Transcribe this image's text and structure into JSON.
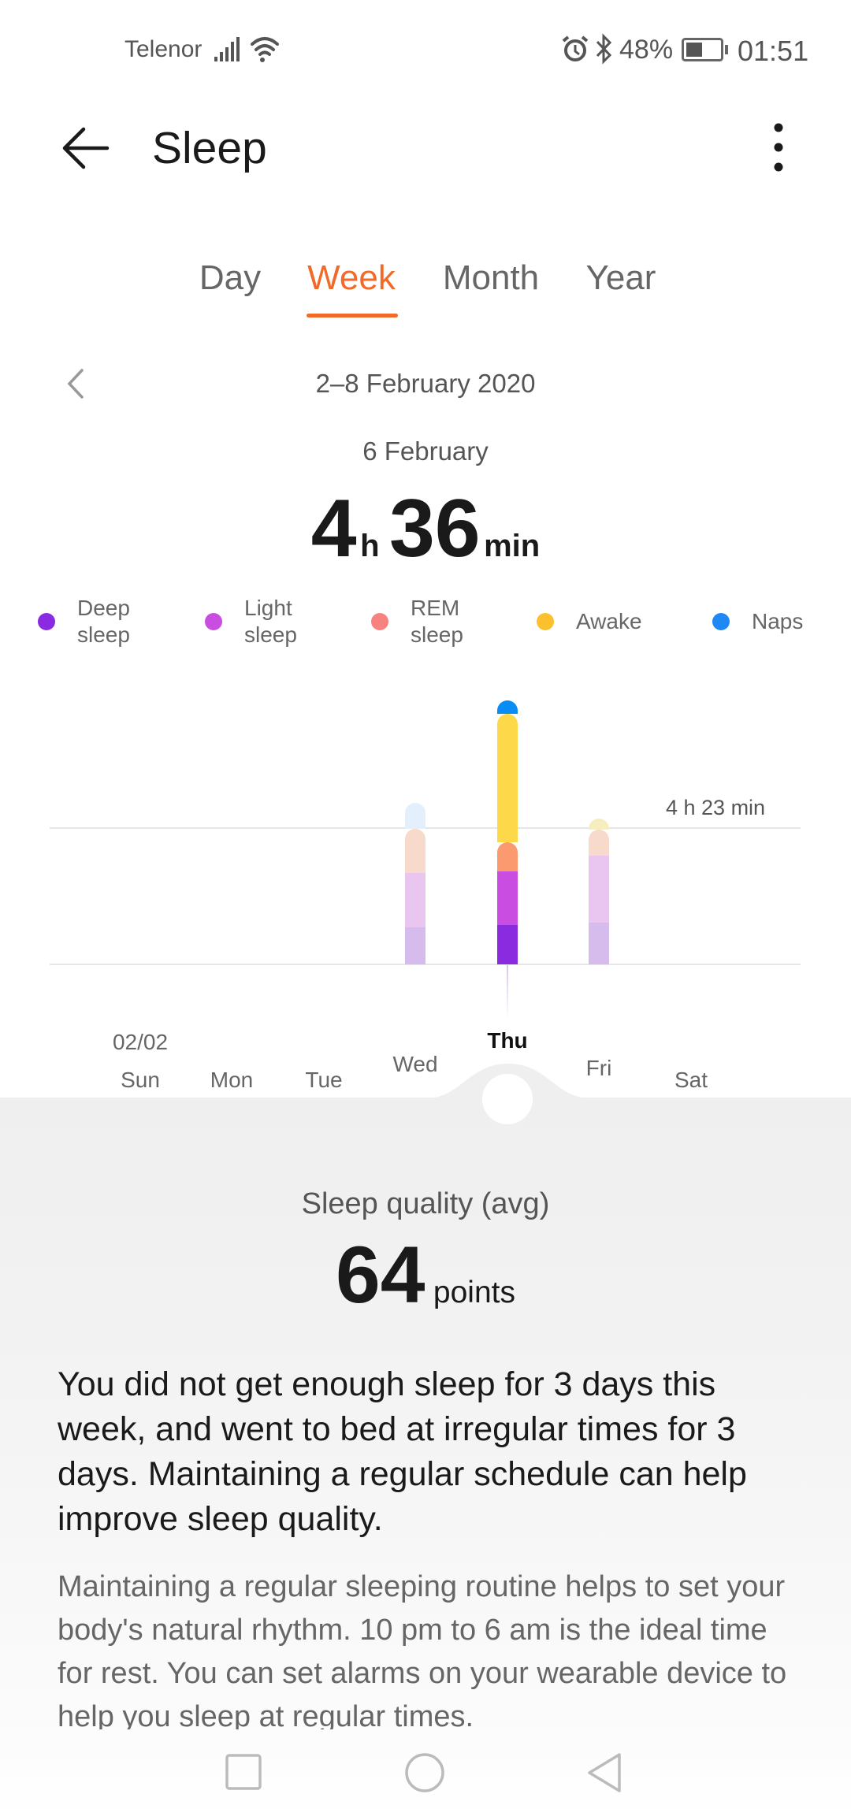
{
  "status_bar": {
    "carrier": "Telenor",
    "battery": "48%",
    "time": "01:51",
    "icons": [
      "signal-icon",
      "wifi-icon",
      "alarm-icon",
      "bluetooth-icon",
      "battery-icon"
    ]
  },
  "header": {
    "title": "Sleep",
    "back_icon": "arrow-left-icon",
    "menu_icon": "more-vertical-icon"
  },
  "tabs": [
    {
      "label": "Day"
    },
    {
      "label": "Week",
      "active": true
    },
    {
      "label": "Month"
    },
    {
      "label": "Year"
    }
  ],
  "period": {
    "range": "2–8 February 2020",
    "selected_date": "6 February",
    "hours": "4",
    "hours_unit": "h",
    "minutes": "36",
    "minutes_unit": "min"
  },
  "legend": [
    {
      "label": "Deep sleep",
      "color": "#8a2be2"
    },
    {
      "label": "Light sleep",
      "color": "#c84de0"
    },
    {
      "label": "REM sleep",
      "color": "#f8827f"
    },
    {
      "label": "Awake",
      "color": "#fbc02d"
    },
    {
      "label": "Naps",
      "color": "#1e88f5"
    }
  ],
  "chart_data": {
    "type": "bar",
    "stacked": true,
    "categories": [
      "Sun",
      "Mon",
      "Tue",
      "Wed",
      "Thu",
      "Fri",
      "Sat"
    ],
    "first_date_label": "02/02",
    "selected": "Thu",
    "reference_line": {
      "value_min": 263,
      "label": "4 h 23 min"
    },
    "series": [
      {
        "name": "Deep sleep",
        "color": "#8b2be0",
        "faded": "#d6bcec",
        "values": [
          0,
          0,
          0,
          71,
          76,
          81,
          0
        ]
      },
      {
        "name": "Light sleep",
        "color": "#c84de0",
        "faded": "#e8c6ef",
        "values": [
          0,
          0,
          0,
          105,
          104,
          129,
          0
        ]
      },
      {
        "name": "REM sleep",
        "color": "#fb9a6e",
        "faded": "#f8dacd",
        "values": [
          0,
          0,
          0,
          86,
          56,
          50,
          0
        ]
      },
      {
        "name": "Awake",
        "color": "#fdd94a",
        "faded": "#f7eec0",
        "values": [
          0,
          0,
          0,
          0,
          247,
          21,
          0
        ]
      },
      {
        "name": "Naps",
        "color": "#0a8cf5",
        "faded": "#e3f0fb",
        "values": [
          0,
          0,
          0,
          49,
          27,
          0,
          0
        ]
      }
    ]
  },
  "quality": {
    "label": "Sleep quality (avg)",
    "value": "64",
    "unit": "points"
  },
  "advice": {
    "summary": "You did not get enough sleep for 3 days this week, and went to bed at irregular times for 3 days. Maintaining a regular schedule can help improve sleep quality.",
    "detail": "Maintaining a regular sleeping routine helps to set your body's natural rhythm. 10 pm to 6 am is the ideal time for rest. You can set alarms on your wearable device to help you sleep at regular times."
  },
  "nav_bar": {
    "icons": [
      "recents-square-icon",
      "home-circle-icon",
      "back-triangle-icon"
    ]
  }
}
